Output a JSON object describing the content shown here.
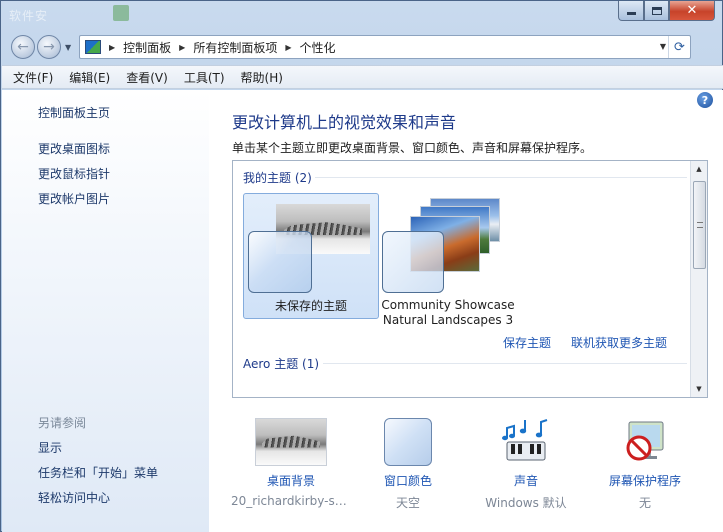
{
  "window": {
    "ghost_title": "软件安",
    "controls": {
      "minimize": "minimize",
      "maximize": "maximize",
      "close": "✕"
    }
  },
  "address": {
    "crumbs": [
      "控制面板",
      "所有控制面板项",
      "个性化"
    ]
  },
  "menubar": {
    "items": [
      "文件(F)",
      "编辑(E)",
      "查看(V)",
      "工具(T)",
      "帮助(H)"
    ]
  },
  "sidebar": {
    "home": "控制面板主页",
    "links": [
      "更改桌面图标",
      "更改鼠标指针",
      "更改帐户图片"
    ],
    "see_also_caption": "另请参阅",
    "see_also": [
      "显示",
      "任务栏和「开始」菜单",
      "轻松访问中心"
    ]
  },
  "main": {
    "title": "更改计算机上的视觉效果和声音",
    "description": "单击某个主题立即更改桌面背景、窗口颜色、声音和屏幕保护程序。",
    "help": "?",
    "my_themes_heading": "我的主题 (2)",
    "themes": [
      {
        "label": "未保存的主题",
        "selected": true
      },
      {
        "label_line1": "Community Showcase",
        "label_line2": "Natural Landscapes 3",
        "selected": false
      }
    ],
    "save_theme": "保存主题",
    "get_more_themes": "联机获取更多主题",
    "aero_heading": "Aero 主题 (1)"
  },
  "bottom": {
    "desktop_background": {
      "title": "桌面背景",
      "value": "20_richardkirby-sn..."
    },
    "window_color": {
      "title": "窗口颜色",
      "value": "天空"
    },
    "sounds": {
      "title": "声音",
      "value": "Windows 默认"
    },
    "screen_saver": {
      "title": "屏幕保护程序",
      "value": "无"
    }
  },
  "colors": {
    "link": "#1f56b3",
    "heading": "#1e3a8a",
    "selected_card": "#cfe1f7",
    "close_button": "#c7432a"
  }
}
